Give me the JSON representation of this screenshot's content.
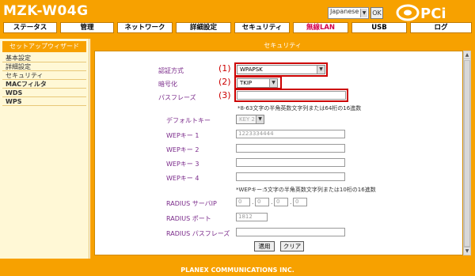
{
  "header": {
    "model": "MZK-W04G",
    "language": "Japanese",
    "ok_label": "OK",
    "logo_text": "PCi"
  },
  "nav": {
    "tabs": [
      {
        "label": "ステータス"
      },
      {
        "label": "管理"
      },
      {
        "label": "ネットワーク"
      },
      {
        "label": "詳細設定"
      },
      {
        "label": "セキュリティ"
      },
      {
        "label": "無線LAN"
      },
      {
        "label": "USB"
      },
      {
        "label": "ログ"
      }
    ]
  },
  "sidebar": {
    "header": "セットアップウィザード",
    "items": [
      {
        "label": "基本設定"
      },
      {
        "label": "詳細設定"
      },
      {
        "label": "セキュリティ"
      },
      {
        "label": "MACフィルタ"
      },
      {
        "label": "WDS"
      },
      {
        "label": "WPS"
      }
    ]
  },
  "panel": {
    "title": "セキュリティ",
    "fields": {
      "auth": {
        "label": "認証方式",
        "value": "WPAPSK",
        "marker": "(1)"
      },
      "encryption": {
        "label": "暗号化",
        "value": "TKIP",
        "marker": "(2)"
      },
      "passphrase": {
        "label": "パスフレーズ",
        "value": "",
        "marker": "(3)"
      },
      "passphrase_note": "*8-63文字の半角英数文字列または64桁の16進数",
      "default_key": {
        "label": "デフォルトキー",
        "value": "KEY 2"
      },
      "wep1": {
        "label": "WEPキー 1",
        "value": "1223334444"
      },
      "wep2": {
        "label": "WEPキー 2",
        "value": ""
      },
      "wep3": {
        "label": "WEPキー 3",
        "value": ""
      },
      "wep4": {
        "label": "WEPキー 4",
        "value": ""
      },
      "wep_note": "*WEPキー:5文字の半角英数文字列または10桁の16進数",
      "radius_ip": {
        "label": "RADIUS サーバIP",
        "octets": [
          "0",
          "0",
          "0",
          "0"
        ]
      },
      "radius_port": {
        "label": "RADIUS ポート",
        "value": "1812"
      },
      "radius_pass": {
        "label": "RADIUS パスフレーズ",
        "value": ""
      }
    },
    "apply_label": "適用",
    "clear_label": "クリア"
  },
  "footer": {
    "text": "PLANEX COMMUNICATIONS INC."
  }
}
